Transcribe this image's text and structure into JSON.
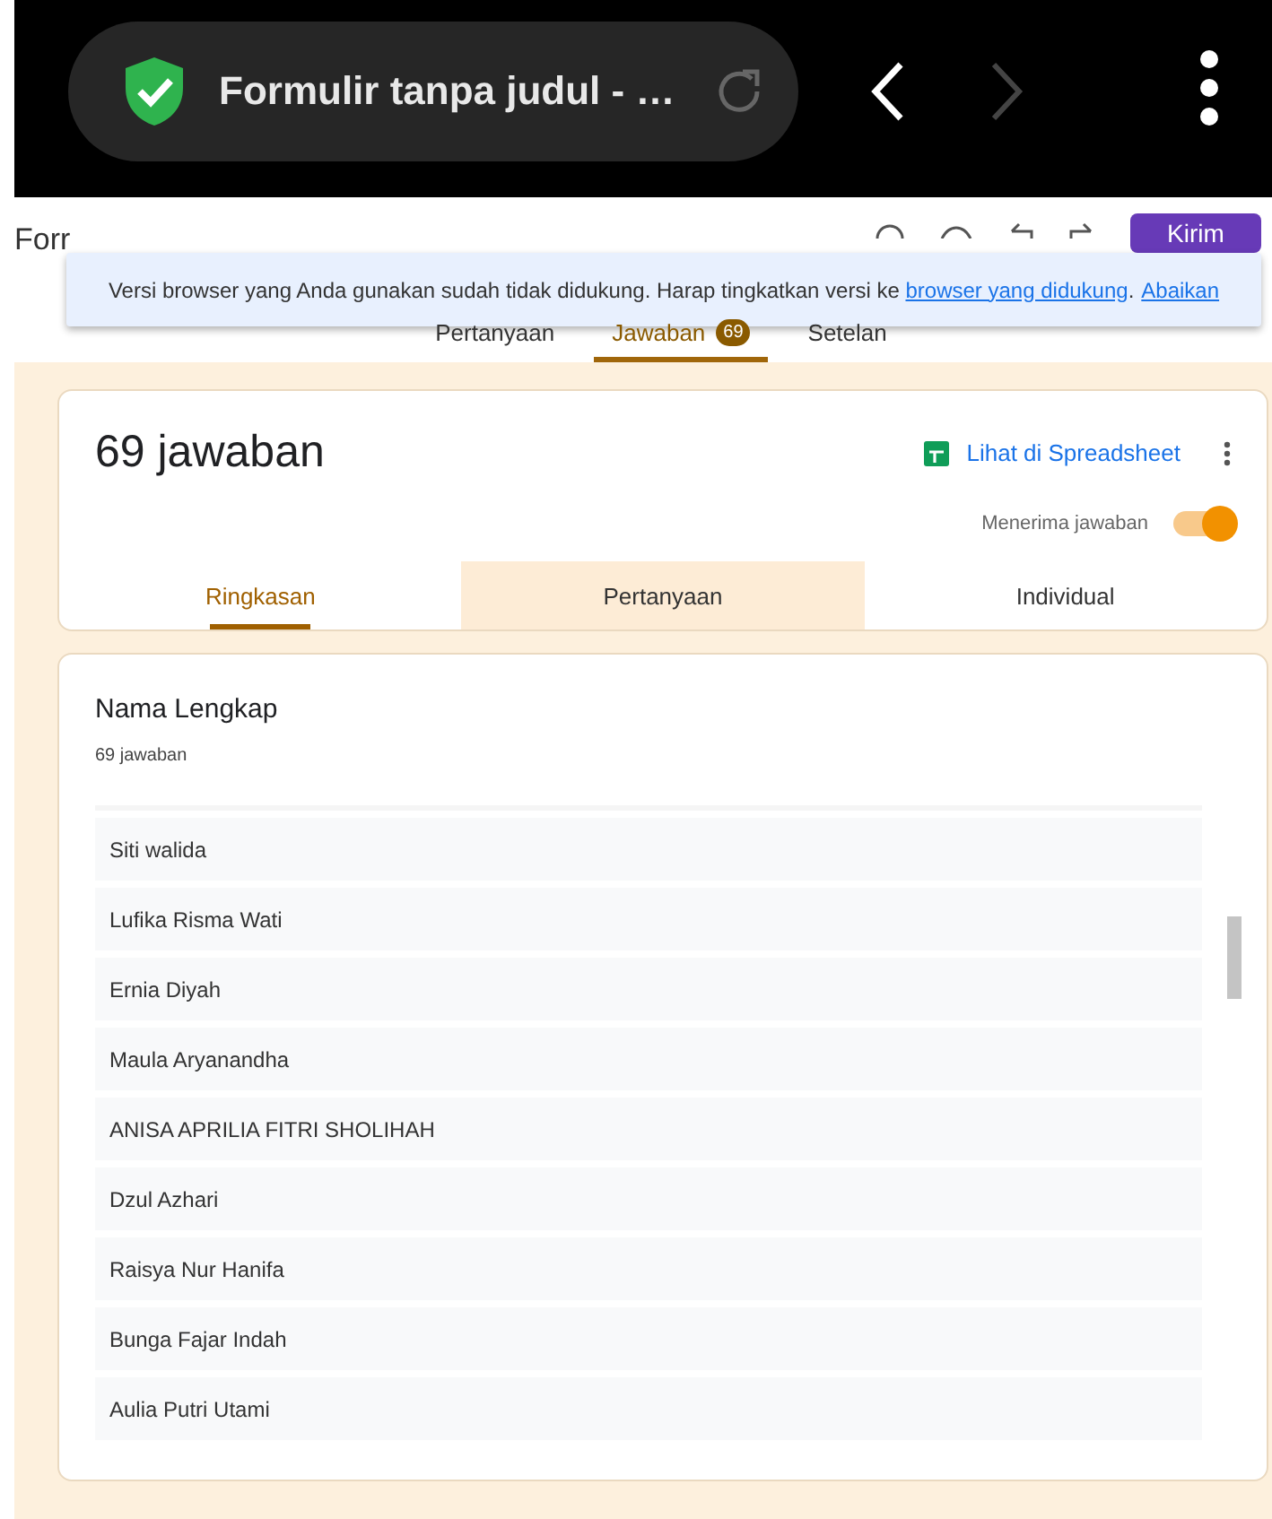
{
  "browser_bar": {
    "title": "Formulir tanpa judul - …"
  },
  "header": {
    "title": "Forr",
    "send_button": "Kirim"
  },
  "banner": {
    "text": "Versi browser yang Anda gunakan sudah tidak didukung. Harap tingkatkan versi ke",
    "link": "browser yang didukung",
    "after_link": ".",
    "dismiss": "Abaikan"
  },
  "tabs": [
    {
      "label": "Pertanyaan",
      "selected": false
    },
    {
      "label": "Jawaban",
      "badge": "69",
      "selected": true
    },
    {
      "label": "Setelan",
      "selected": false
    }
  ],
  "summary": {
    "title": "69 jawaban",
    "spreadsheet_link": "Lihat di Spreadsheet",
    "accepting_label": "Menerima jawaban",
    "accepting": true,
    "tabs": [
      {
        "label": "Ringkasan",
        "selected": true,
        "hovered": false
      },
      {
        "label": "Pertanyaan",
        "selected": false,
        "hovered": true
      },
      {
        "label": "Individual",
        "selected": false,
        "hovered": false
      }
    ]
  },
  "question": {
    "title": "Nama Lengkap",
    "count": "69 jawaban",
    "answers": [
      "Siti walida",
      "Lufika Risma Wati",
      "Ernia Diyah",
      "Maula Aryanandha",
      "ANISA APRILIA FITRI SHOLIHAH",
      "Dzul Azhari",
      "Raisya Nur Hanifa",
      "Bunga Fajar Indah",
      "Aulia Putri Utami"
    ]
  }
}
